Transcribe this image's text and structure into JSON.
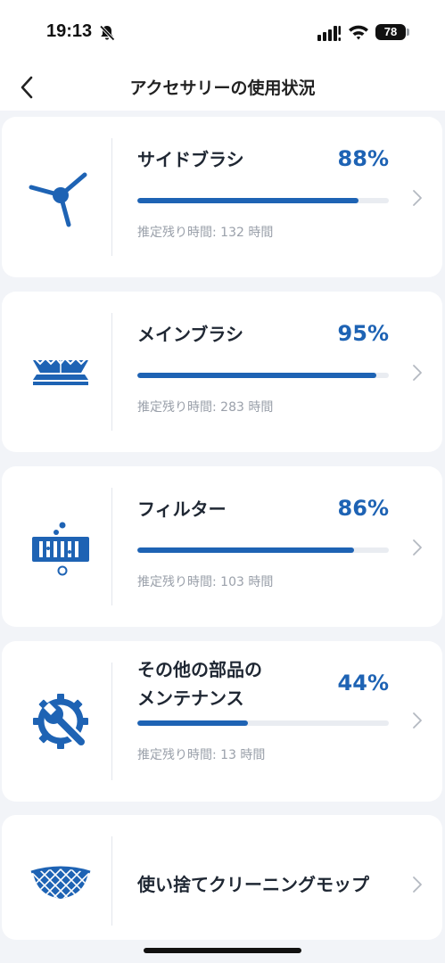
{
  "status_bar": {
    "time": "19:13",
    "battery": "78",
    "icons": [
      "bell-slash-icon",
      "signal-icon",
      "wifi-icon",
      "battery-icon"
    ]
  },
  "nav": {
    "title": "アクセサリーの使用状況",
    "back_icon": "chevron-left-icon"
  },
  "accessories": [
    {
      "name": "サイドブラシ",
      "percent_label": "88%",
      "percent": 88,
      "remaining": "推定残り時間: 132 時間",
      "icon": "side-brush-icon"
    },
    {
      "name": "メインブラシ",
      "percent_label": "95%",
      "percent": 95,
      "remaining": "推定残り時間: 283 時間",
      "icon": "main-brush-icon"
    },
    {
      "name": "フィルター",
      "percent_label": "86%",
      "percent": 86,
      "remaining": "推定残り時間: 103 時間",
      "icon": "filter-icon"
    },
    {
      "name_line1": "その他の部品の",
      "name_line2": "メンテナンス",
      "percent_label": "44%",
      "percent": 44,
      "remaining": "推定残り時間: 13 時間",
      "icon": "maintenance-gear-wrench-icon"
    },
    {
      "name": "使い捨てクリーニングモップ",
      "icon": "disposable-mop-icon"
    }
  ],
  "colors": {
    "accent": "#1e63b4",
    "background": "#f2f4f8",
    "track": "#e9ecf1"
  }
}
